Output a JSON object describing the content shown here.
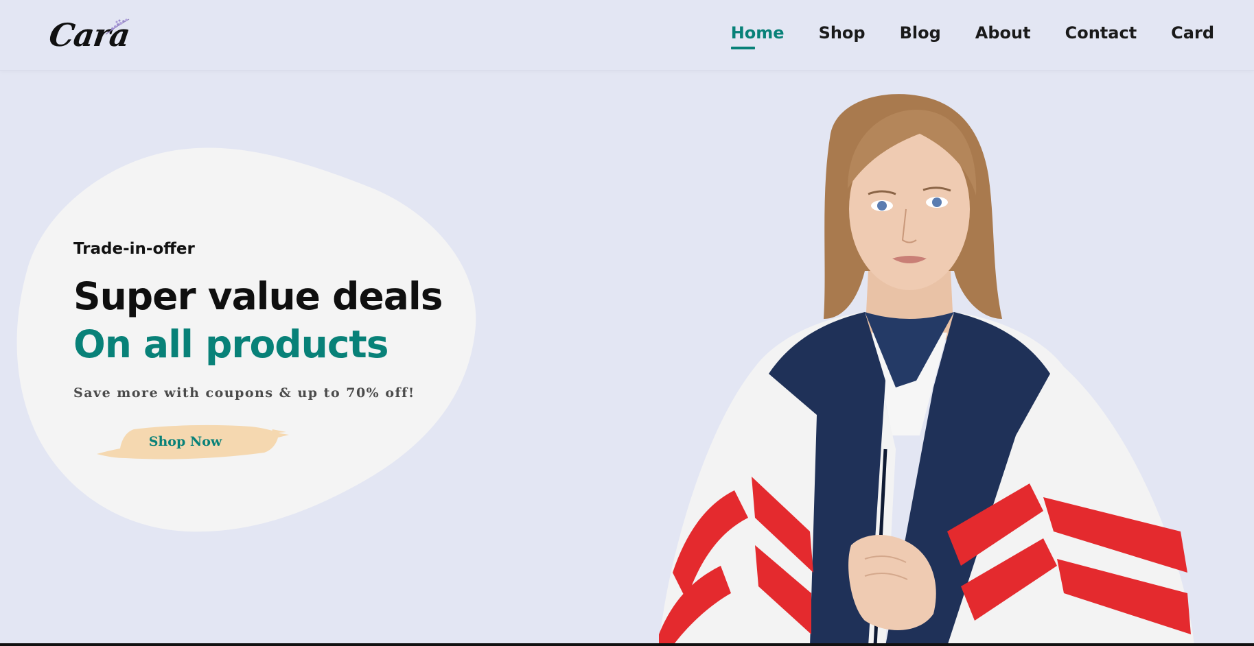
{
  "brand": {
    "logo_text": "Cara"
  },
  "nav": {
    "items": [
      {
        "label": "Home",
        "active": true
      },
      {
        "label": "Shop",
        "active": false
      },
      {
        "label": "Blog",
        "active": false
      },
      {
        "label": "About",
        "active": false
      },
      {
        "label": "Contact",
        "active": false
      },
      {
        "label": "Card",
        "active": false
      }
    ]
  },
  "hero": {
    "eyebrow": "Trade-in-offer",
    "headline_line1": "Super value deals",
    "headline_line2": "On all products",
    "tagline": "Save more with coupons & up to 70% off!",
    "cta_label": "Shop Now",
    "image_alt": "model-wearing-jacket-photo"
  },
  "colors": {
    "accent": "#088178",
    "background": "#e3e6f3",
    "blob": "#f4f4f4",
    "button_brush": "#f5d8b0",
    "jacket_navy": "#1f3158",
    "jacket_red": "#e42a2e"
  }
}
